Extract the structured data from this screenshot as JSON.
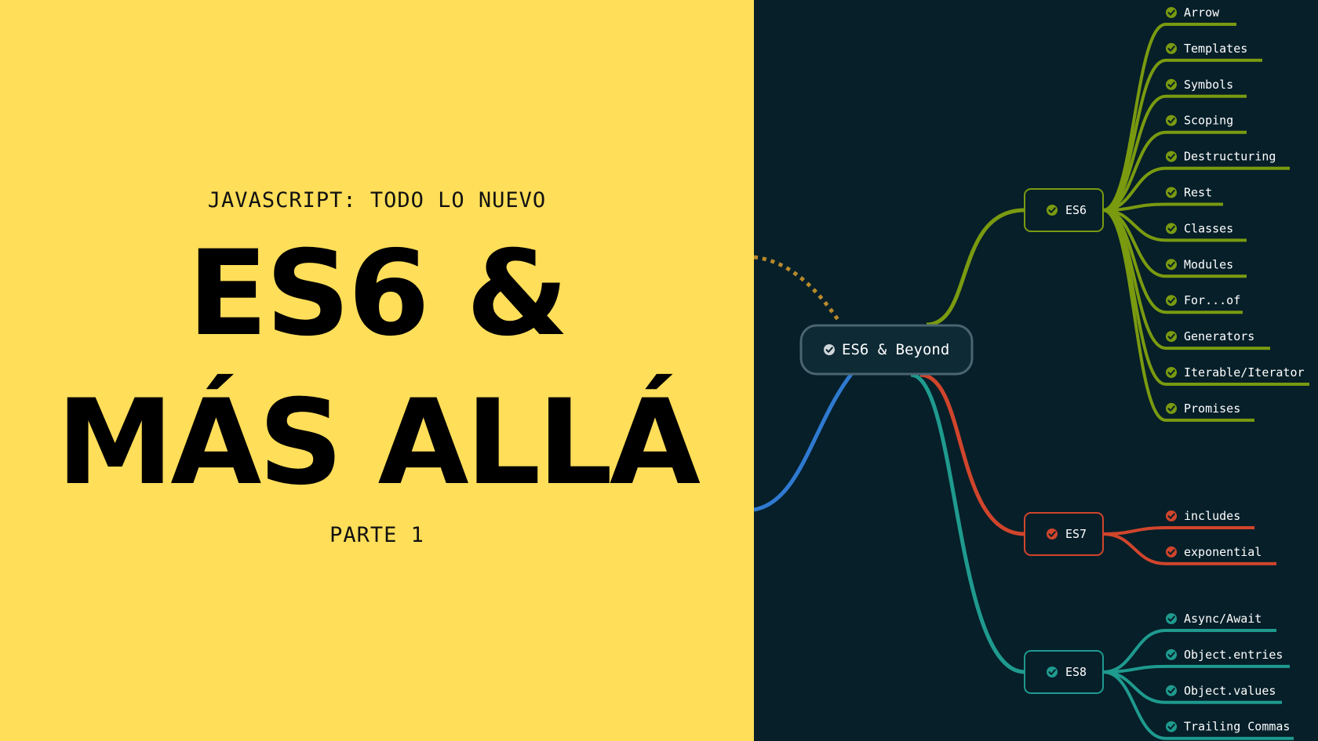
{
  "left": {
    "kicker": "JAVASCRIPT: TODO LO NUEVO",
    "title_line1": "ES6 &",
    "title_line2": "MÁS ALLÁ",
    "subtitle": "PARTE 1"
  },
  "mindmap": {
    "root": "ES6 & Beyond",
    "colors": {
      "background": "#061f29",
      "root": "#cfd6d9",
      "dotted": "#b8892b",
      "blue": "#2f7ad1"
    },
    "branches": [
      {
        "name": "ES6",
        "color": "#7a9a10",
        "items": [
          "Arrow",
          "Templates",
          "Symbols",
          "Scoping",
          "Destructuring",
          "Rest",
          "Classes",
          "Modules",
          "For...of",
          "Generators",
          "Iterable/Iterator",
          "Promises"
        ]
      },
      {
        "name": "ES7",
        "color": "#d0452c",
        "items": [
          "includes",
          "exponential"
        ]
      },
      {
        "name": "ES8",
        "color": "#1f9a8e",
        "items": [
          "Async/Await",
          "Object.entries",
          "Object.values",
          "Trailing Commas"
        ]
      }
    ]
  }
}
